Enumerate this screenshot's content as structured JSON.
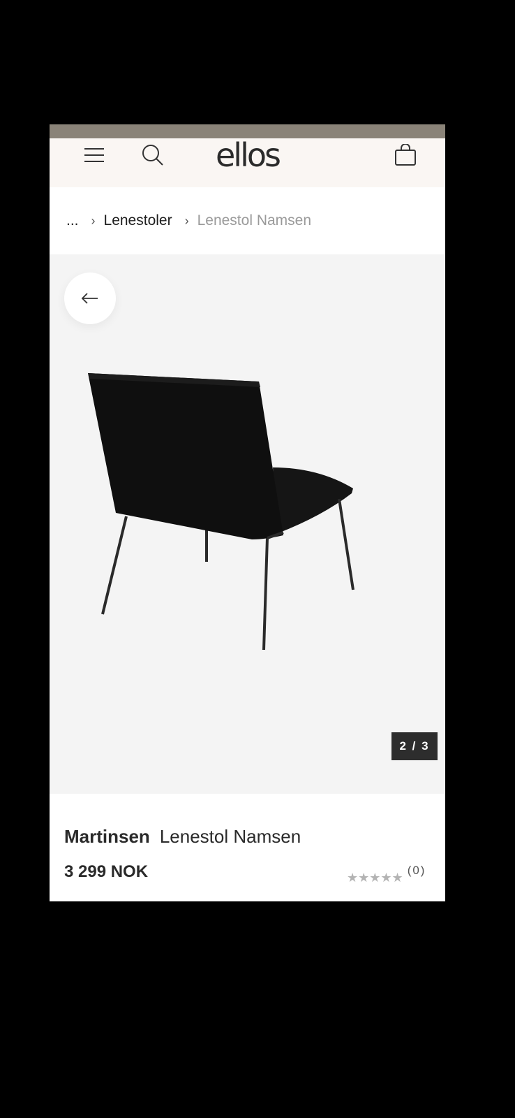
{
  "header": {
    "logo": "ellos",
    "icons": [
      "menu-icon",
      "search-icon",
      "shopping-bag-icon"
    ]
  },
  "breadcrumb": {
    "ellipsis": "...",
    "category": "Lenestoler",
    "current": "Lenestol Namsen"
  },
  "gallery": {
    "counter": "2 / 3",
    "back_icon": "arrow-left-icon"
  },
  "product": {
    "brand": "Martinsen",
    "name": "Lenestol Namsen",
    "price": "3 299 NOK",
    "stars": "★★★★★",
    "review_count": "(0)"
  },
  "colors": {
    "status_strip": "#8a8378",
    "header_bg": "#faf6f3",
    "gallery_bg": "#f4f4f4",
    "counter_bg": "#2d2d2d"
  }
}
